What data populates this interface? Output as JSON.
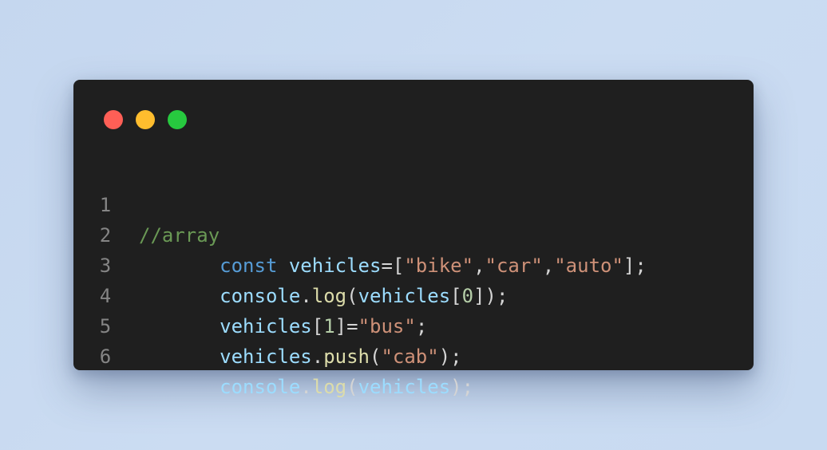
{
  "window": {
    "controls": [
      {
        "name": "close",
        "color": "#ff5f56"
      },
      {
        "name": "minimize",
        "color": "#ffbd2e"
      },
      {
        "name": "maximize",
        "color": "#27c93f"
      }
    ]
  },
  "editor": {
    "language": "javascript",
    "lines": [
      {
        "number": "1",
        "indent": "",
        "tokens": [
          {
            "t": "//array",
            "c": "comment"
          }
        ]
      },
      {
        "number": "2",
        "indent": "       ",
        "tokens": [
          {
            "t": "const",
            "c": "kw"
          },
          {
            "t": " ",
            "c": "punct"
          },
          {
            "t": "vehicles",
            "c": "var"
          },
          {
            "t": "=[",
            "c": "punct"
          },
          {
            "t": "\"bike\"",
            "c": "str"
          },
          {
            "t": ",",
            "c": "punct"
          },
          {
            "t": "\"car\"",
            "c": "str"
          },
          {
            "t": ",",
            "c": "punct"
          },
          {
            "t": "\"auto\"",
            "c": "str"
          },
          {
            "t": "];",
            "c": "punct"
          }
        ]
      },
      {
        "number": "3",
        "indent": "       ",
        "tokens": [
          {
            "t": "console",
            "c": "var"
          },
          {
            "t": ".",
            "c": "punct"
          },
          {
            "t": "log",
            "c": "fn"
          },
          {
            "t": "(",
            "c": "punct"
          },
          {
            "t": "vehicles",
            "c": "var"
          },
          {
            "t": "[",
            "c": "punct"
          },
          {
            "t": "0",
            "c": "num"
          },
          {
            "t": "]);",
            "c": "punct"
          }
        ]
      },
      {
        "number": "4",
        "indent": "       ",
        "tokens": [
          {
            "t": "vehicles",
            "c": "var"
          },
          {
            "t": "[",
            "c": "punct"
          },
          {
            "t": "1",
            "c": "num"
          },
          {
            "t": "]=",
            "c": "punct"
          },
          {
            "t": "\"bus\"",
            "c": "str"
          },
          {
            "t": ";",
            "c": "punct"
          }
        ]
      },
      {
        "number": "5",
        "indent": "       ",
        "tokens": [
          {
            "t": "vehicles",
            "c": "var"
          },
          {
            "t": ".",
            "c": "punct"
          },
          {
            "t": "push",
            "c": "fn"
          },
          {
            "t": "(",
            "c": "punct"
          },
          {
            "t": "\"cab\"",
            "c": "str"
          },
          {
            "t": ");",
            "c": "punct"
          }
        ]
      },
      {
        "number": "6",
        "indent": "       ",
        "tokens": [
          {
            "t": "console",
            "c": "var"
          },
          {
            "t": ".",
            "c": "punct"
          },
          {
            "t": "log",
            "c": "fn"
          },
          {
            "t": "(",
            "c": "punct"
          },
          {
            "t": "vehicles",
            "c": "var"
          },
          {
            "t": ");",
            "c": "punct"
          }
        ]
      }
    ]
  }
}
